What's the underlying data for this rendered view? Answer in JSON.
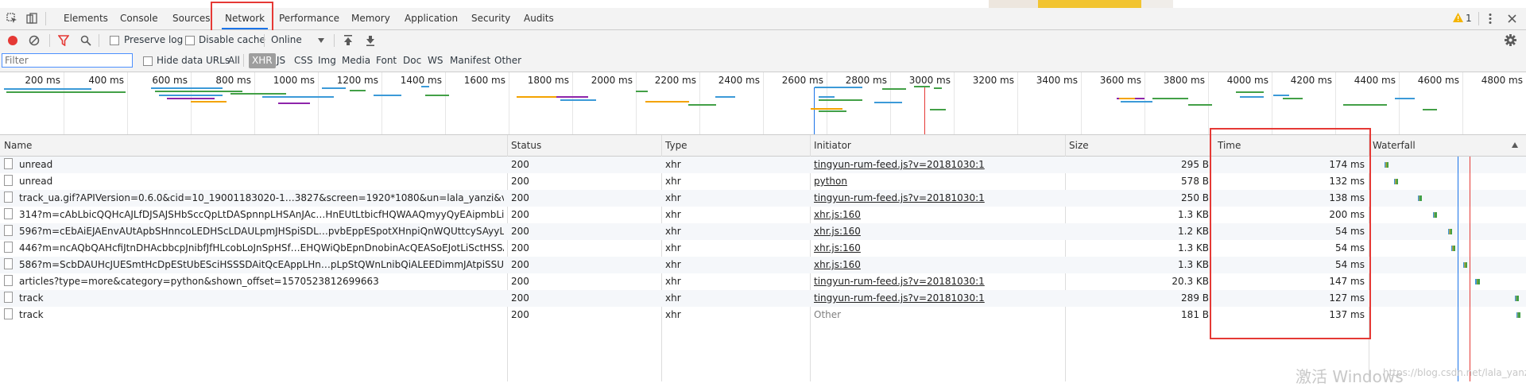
{
  "tabs": [
    "Elements",
    "Console",
    "Sources",
    "Network",
    "Performance",
    "Memory",
    "Application",
    "Security",
    "Audits"
  ],
  "warning_count": "1",
  "toolbar": {
    "preserve_log": "Preserve log",
    "disable_cache": "Disable cache",
    "throttle": "Online"
  },
  "filter": {
    "placeholder": "Filter",
    "hide_data_urls": "Hide data URLs",
    "types": [
      "All",
      "XHR",
      "JS",
      "CSS",
      "Img",
      "Media",
      "Font",
      "Doc",
      "WS",
      "Manifest",
      "Other"
    ],
    "active_type": "XHR"
  },
  "overview": {
    "ticks": [
      "200 ms",
      "400 ms",
      "600 ms",
      "800 ms",
      "1000 ms",
      "1200 ms",
      "1400 ms",
      "1600 ms",
      "1800 ms",
      "2000 ms",
      "2200 ms",
      "2400 ms",
      "2600 ms",
      "2800 ms",
      "3000 ms",
      "3200 ms",
      "3400 ms",
      "3600 ms",
      "3800 ms",
      "4000 ms",
      "4200 ms",
      "4400 ms",
      "4600 ms",
      "4800 ms"
    ]
  },
  "columns": {
    "name": "Name",
    "status": "Status",
    "type": "Type",
    "initiator": "Initiator",
    "size": "Size",
    "time": "Time",
    "waterfall": "Waterfall"
  },
  "requests": [
    {
      "name": "unread",
      "status": "200",
      "type": "xhr",
      "initiator": "tingyun-rum-feed.js?v=20181030:1",
      "size": "295 B",
      "time": "174 ms",
      "wf_start": 0.08,
      "wf_len": 0.012
    },
    {
      "name": "unread",
      "status": "200",
      "type": "xhr",
      "initiator": "python",
      "size": "578 B",
      "time": "132 ms",
      "wf_start": 0.14,
      "wf_len": 0.01
    },
    {
      "name": "track_ua.gif?APIVersion=0.6.0&cid=10_19001183020-1…3827&screen=1920*1080&un=lala_yanzi&vType=U000000",
      "status": "200",
      "type": "xhr",
      "initiator": "tingyun-rum-feed.js?v=20181030:1",
      "size": "250 B",
      "time": "138 ms",
      "wf_start": 0.3,
      "wf_len": 0.012
    },
    {
      "name": "314?m=cAbLbicQQHcAJLfDJSAJSHbSccQpLtDASpnnpLHSAnJAc…HnEUtLtbicfHQWAAQmyyQyEAipmbLiiUptHJJEiD…",
      "status": "200",
      "type": "xhr",
      "initiator": "xhr.js:160",
      "size": "1.3 KB",
      "time": "200 ms",
      "wf_start": 0.4,
      "wf_len": 0.015
    },
    {
      "name": "596?m=cEbAiEJAEnvAUtApbSHnncoLEDHScLDAULpmJHSpiSDL…pvbEppESpotXHnpiQnWQUttcySAyyLiSbQoSEpJ…",
      "status": "200",
      "type": "xhr",
      "initiator": "xhr.js:160",
      "size": "1.2 KB",
      "time": "54 ms",
      "wf_start": 0.5,
      "wf_len": 0.006
    },
    {
      "name": "446?m=ncAQbQAHcfiJtnDHAcbbcpJnibfJfHLcobLoJnSpHSf…EHQWiQbEpnDnobinAcQEASoEJotLiSctHSSALpAbp…",
      "status": "200",
      "type": "xhr",
      "initiator": "xhr.js:160",
      "size": "1.3 KB",
      "time": "54 ms",
      "wf_start": 0.52,
      "wf_len": 0.006
    },
    {
      "name": "586?m=ScbDAUHcJUESmtHcDpEStUbESciHSSSDAitQcEAppLHn…pLpStQWnLnibQiALEEDimmJAtpiSSUQbonJpipb…",
      "status": "200",
      "type": "xhr",
      "initiator": "xhr.js:160",
      "size": "1.3 KB",
      "time": "54 ms",
      "wf_start": 0.6,
      "wf_len": 0.006
    },
    {
      "name": "articles?type=more&category=python&shown_offset=1570523812699663",
      "status": "200",
      "type": "xhr",
      "initiator": "tingyun-rum-feed.js?v=20181030:1",
      "size": "20.3 KB",
      "time": "147 ms",
      "wf_start": 0.68,
      "wf_len": 0.03
    },
    {
      "name": "track",
      "status": "200",
      "type": "xhr",
      "initiator": "tingyun-rum-feed.js?v=20181030:1",
      "size": "289 B",
      "time": "127 ms",
      "wf_start": 0.94,
      "wf_len": 0.012
    },
    {
      "name": "track",
      "status": "200",
      "type": "xhr",
      "initiator": "Other",
      "size": "181 B",
      "time": "137 ms",
      "wf_start": 0.95,
      "wf_len": 0.012
    }
  ],
  "watermark": "激活 Windows",
  "watermark_url": "https://blog.csdn.net/lala_yanzi"
}
